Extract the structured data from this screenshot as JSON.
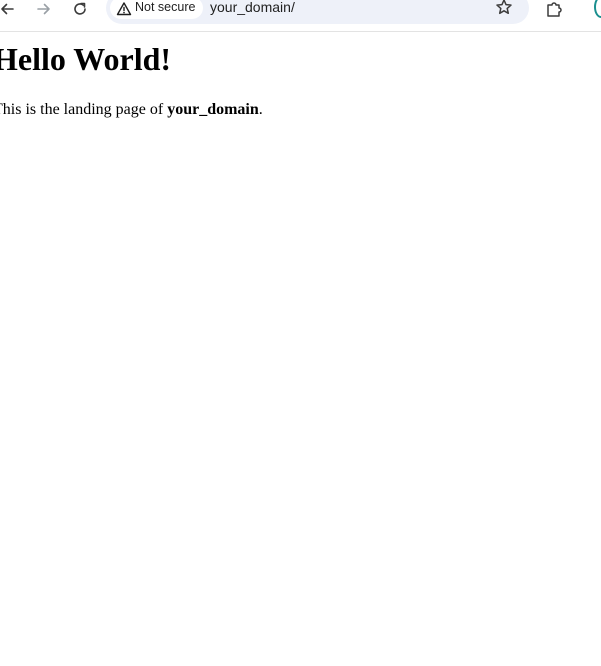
{
  "browser": {
    "back_icon": "arrow-left-icon",
    "forward_icon": "arrow-right-icon",
    "reload_icon": "reload-icon",
    "security_label": "Not secure",
    "security_icon": "warning-triangle-icon",
    "url": "your_domain/",
    "bookmark_icon": "star-icon",
    "extensions_icon": "puzzle-icon",
    "profile_color": "#1a8f8f"
  },
  "page": {
    "heading": "Hello World!",
    "paragraph_prefix": "This is the landing page of ",
    "paragraph_domain": "your_domain",
    "paragraph_suffix": "."
  }
}
